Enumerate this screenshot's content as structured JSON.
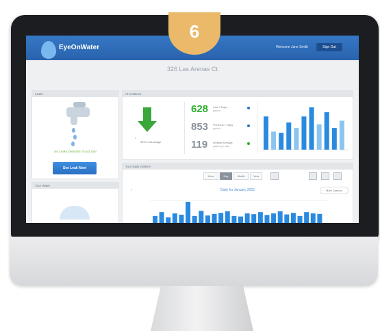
{
  "badge": {
    "step": "6"
  },
  "header": {
    "brand": "EyeOnWater",
    "welcome": "Welcome Jane Smith",
    "signout": "Sign Out"
  },
  "address": "326 Las Arenas Ct",
  "leaks": {
    "title": "Leaks",
    "status": "No Leaks Detected. Good Job!",
    "button": "See Leak Alert"
  },
  "weather": {
    "title": "Your Water"
  },
  "usage": {
    "title": "At a Glance",
    "percent_text": "26% Less Usage",
    "stats": [
      {
        "value": "628",
        "label": "Last 7 Days",
        "sub": "gallons",
        "color": "#2eae2e",
        "dot": "#2a72c7"
      },
      {
        "value": "853",
        "label": "Previous 7 Days",
        "sub": "gallons",
        "color": "#8a929b",
        "dot": "#2a72c7"
      },
      {
        "value": "119",
        "label": "Weekly Average",
        "sub": "gallons per day",
        "color": "#8a929b",
        "dot": "#2eae2e"
      }
    ]
  },
  "mini_chart": {
    "bar_color": "#2a8ae0",
    "light_color": "#8cc4f0",
    "values": [
      55,
      30,
      28,
      45,
      36,
      55,
      70,
      42,
      62,
      36,
      48
    ]
  },
  "details": {
    "title": "Your Daily Gallons",
    "tabs": [
      "Hour",
      "Day",
      "Month",
      "Year"
    ],
    "active_tab": "Day",
    "daily_title": "Daily for January 2015",
    "more_btn": "More Options",
    "bar_values": [
      40,
      55,
      35,
      50,
      45,
      95,
      40,
      60,
      42,
      48,
      52,
      58,
      40,
      38,
      50,
      47,
      55,
      44,
      50,
      58,
      46,
      52,
      40,
      55,
      50,
      48
    ]
  }
}
